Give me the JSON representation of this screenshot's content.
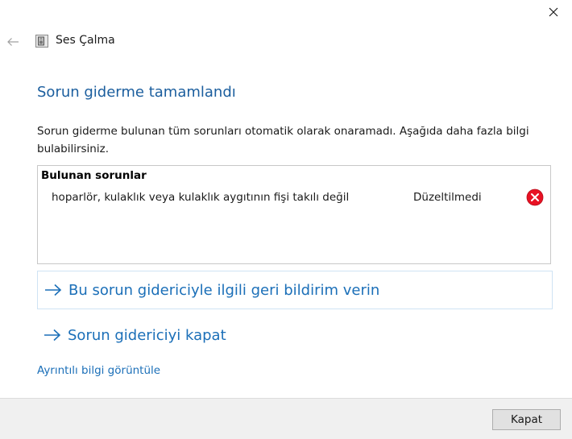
{
  "window": {
    "title": "Ses Çalma",
    "close_icon": "close-icon",
    "back_icon": "back-arrow-icon",
    "app_icon": "speaker-app-icon"
  },
  "content": {
    "heading": "Sorun giderme tamamlandı",
    "description": "Sorun giderme bulunan tüm sorunları otomatik olarak onaramadı. Aşağıda daha fazla bilgi bulabilirsiniz.",
    "problems": {
      "header": "Bulunan sorunlar",
      "items": [
        {
          "text": "hoparlör, kulaklık veya kulaklık aygıtının fişi takılı değil",
          "status": "Düzeltilmedi",
          "status_icon": "error-icon",
          "status_color": "#e81123"
        }
      ]
    },
    "links": {
      "feedback": "Bu sorun gidericiyle ilgili geri bildirim verin",
      "close_troubleshooter": "Sorun gidericiyi kapat",
      "details": "Ayrıntılı bilgi görüntüle"
    }
  },
  "footer": {
    "close_button": "Kapat"
  },
  "colors": {
    "heading": "#1b5e9e",
    "link": "#1b6fb8",
    "footer_bg": "#f0f0f0"
  }
}
